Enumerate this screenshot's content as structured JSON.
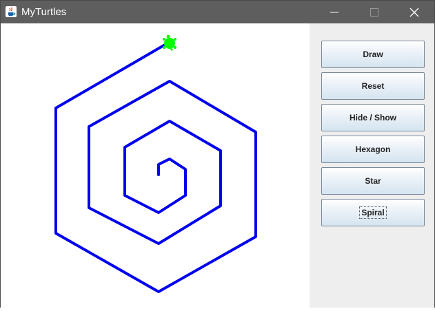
{
  "window": {
    "title": "MyTurtles",
    "app_icon": "java-cup-icon",
    "controls": {
      "minimize_icon": "minimize-icon",
      "maximize_icon": "maximize-icon",
      "close_icon": "close-icon"
    }
  },
  "canvas": {
    "turtle_icon": "turtle-icon",
    "turtle_color": "#00ff00",
    "pen_color": "#0000ee",
    "background": "#ffffff"
  },
  "sidepanel": {
    "buttons": [
      {
        "label": "Draw"
      },
      {
        "label": "Reset"
      },
      {
        "label": "Hide / Show"
      },
      {
        "label": "Hexagon"
      },
      {
        "label": "Star"
      },
      {
        "label": "Spiral",
        "focused": true
      }
    ]
  },
  "colors": {
    "titlebar": "#5e5e5e",
    "panel": "#eeeeee"
  }
}
